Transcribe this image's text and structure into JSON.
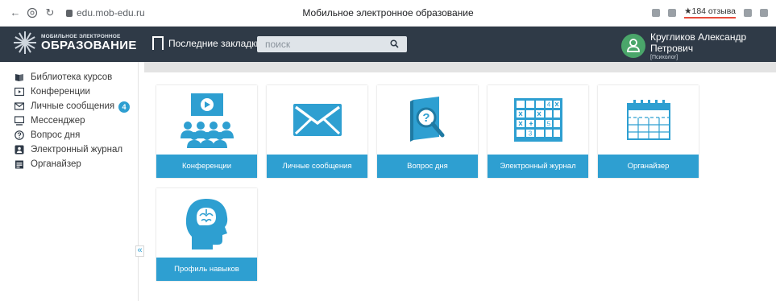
{
  "browser": {
    "url": "edu.mob-edu.ru",
    "title": "Мобильное электронное образование",
    "reviews": "★184 отзыва"
  },
  "header": {
    "logo_line1": "МОБИЛЬНОЕ ЭЛЕКТРОННОЕ",
    "logo_line2": "ОБРАЗОВАНИЕ",
    "bookmarks": "Последние закладки",
    "search_placeholder": "ПОИСК",
    "user_name": "Кругликов Александр Петрович",
    "user_role": "[Психолог]"
  },
  "sidebar": {
    "items": [
      {
        "label": "Библиотека курсов",
        "icon": "book-icon"
      },
      {
        "label": "Конференции",
        "icon": "video-icon"
      },
      {
        "label": "Личные сообщения",
        "icon": "mail-icon",
        "badge": "4"
      },
      {
        "label": "Мессенджер",
        "icon": "chat-icon"
      },
      {
        "label": "Вопрос дня",
        "icon": "question-icon"
      },
      {
        "label": "Электронный журнал",
        "icon": "journal-icon"
      },
      {
        "label": "Органайзер",
        "icon": "organizer-icon"
      }
    ],
    "collapse_symbol": "«"
  },
  "tiles": [
    {
      "label": "Конференции",
      "icon": "conference-icon"
    },
    {
      "label": "Личные сообщения",
      "icon": "envelope-icon"
    },
    {
      "label": "Вопрос дня",
      "icon": "question-search-icon"
    },
    {
      "label": "Электронный журнал",
      "icon": "grade-table-icon"
    },
    {
      "label": "Органайзер",
      "icon": "calendar-icon"
    },
    {
      "label": "Профиль навыков",
      "icon": "brain-head-icon"
    }
  ],
  "journal_cells": [
    "4",
    "5",
    "3"
  ],
  "colors": {
    "accent": "#2e9fd1",
    "header_bg": "#2f3a47",
    "avatar": "#4aa66a"
  }
}
